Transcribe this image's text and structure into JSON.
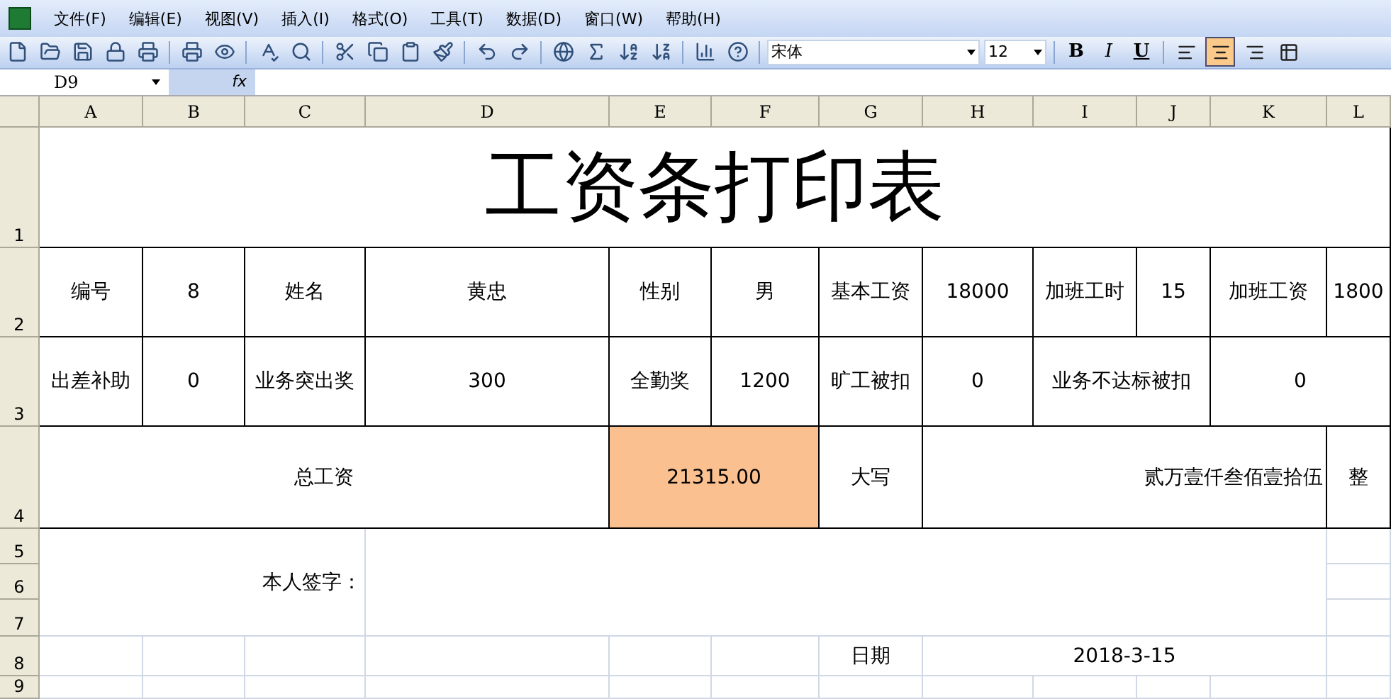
{
  "menu": [
    "文件(F)",
    "编辑(E)",
    "视图(V)",
    "插入(I)",
    "格式(O)",
    "工具(T)",
    "数据(D)",
    "窗口(W)",
    "帮助(H)"
  ],
  "toolbar": {
    "font": "宋体",
    "size": "12",
    "format_buttons": [
      "B",
      "I",
      "U"
    ],
    "align_buttons": [
      {
        "kind": "left",
        "selected": false
      },
      {
        "kind": "center",
        "selected": true
      },
      {
        "kind": "right",
        "selected": false
      },
      {
        "kind": "merge",
        "selected": false
      }
    ]
  },
  "formula_bar": {
    "name_box": "D9",
    "fx": "fx"
  },
  "columns": [
    "A",
    "B",
    "C",
    "D",
    "E",
    "F",
    "G",
    "H",
    "I",
    "J",
    "K",
    "L"
  ],
  "rows": [
    {
      "number": "1",
      "cells": [
        {
          "text": "工资条打印表"
        }
      ]
    },
    {
      "number": "2",
      "cells": [
        {
          "text": "编号"
        },
        {
          "text": "8"
        },
        {
          "text": "姓名"
        },
        {
          "text": "黄忠"
        },
        {
          "text": "性别"
        },
        {
          "text": "男"
        },
        {
          "text": "基本工资"
        },
        {
          "text": "18000"
        },
        {
          "text": "加班工时"
        },
        {
          "text": "15"
        },
        {
          "text": "加班工资"
        },
        {
          "text": "1800"
        }
      ]
    },
    {
      "number": "3",
      "cells": [
        {
          "text": "出差补助"
        },
        {
          "text": "0"
        },
        {
          "text": "业务突出奖"
        },
        {
          "text": "300"
        },
        {
          "text": "全勤奖"
        },
        {
          "text": "1200"
        },
        {
          "text": "旷工被扣"
        },
        {
          "text": "0"
        },
        {
          "text": "业务不达标被扣"
        },
        {
          "text": "0"
        }
      ]
    },
    {
      "number": "4",
      "cells": [
        {
          "text": "总工资"
        },
        {
          "text": "21315.00",
          "highlighted": true
        },
        {
          "text": "大写"
        },
        {
          "text": "贰万壹仟叁佰壹拾伍"
        },
        {
          "text": "整"
        }
      ]
    },
    {
      "number": "5",
      "cells": [
        {
          "text": "本人签字："
        }
      ]
    },
    {
      "number": "6"
    },
    {
      "number": "7"
    },
    {
      "number": "8",
      "cells": [
        {
          "text": "日期"
        },
        {
          "text": "2018-3-15"
        }
      ]
    },
    {
      "number": "9"
    }
  ]
}
